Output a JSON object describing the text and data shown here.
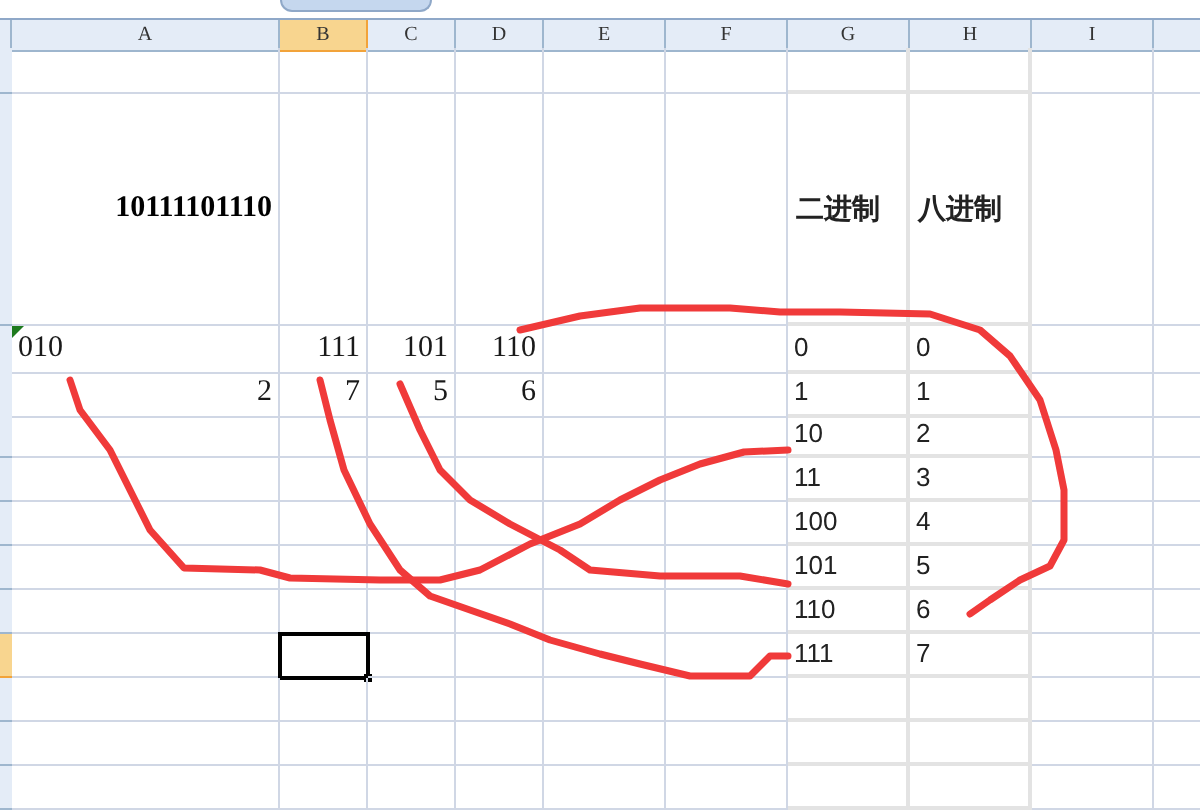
{
  "columns": [
    {
      "label": "A",
      "selected": false
    },
    {
      "label": "B",
      "selected": true
    },
    {
      "label": "C",
      "selected": false
    },
    {
      "label": "D",
      "selected": false
    },
    {
      "label": "E",
      "selected": false
    },
    {
      "label": "F",
      "selected": false
    },
    {
      "label": "G",
      "selected": false
    },
    {
      "label": "H",
      "selected": false
    },
    {
      "label": "I",
      "selected": false
    }
  ],
  "rows": [
    {
      "selected": false,
      "cells": [
        null,
        null,
        null,
        null,
        null,
        null,
        null,
        null,
        null
      ]
    },
    {
      "selected": false,
      "cells": [
        {
          "kind": "heading",
          "text": "10111101110"
        },
        null,
        null,
        null,
        null,
        null,
        {
          "kind": "table-heading",
          "text": "二进制"
        },
        {
          "kind": "table-heading",
          "text": "八进制"
        },
        null
      ]
    },
    {
      "selected": false,
      "cells": [
        {
          "kind": "text",
          "text": "010",
          "flagged": true
        },
        {
          "kind": "number",
          "text": "111"
        },
        {
          "kind": "number",
          "text": "101"
        },
        {
          "kind": "number",
          "text": "110"
        },
        null,
        null,
        {
          "kind": "table",
          "text": "0"
        },
        {
          "kind": "table",
          "text": "0"
        },
        null
      ]
    },
    {
      "selected": false,
      "cells": [
        {
          "kind": "number",
          "text": "2"
        },
        {
          "kind": "number",
          "text": "7"
        },
        {
          "kind": "number",
          "text": "5"
        },
        {
          "kind": "number",
          "text": "6"
        },
        null,
        null,
        {
          "kind": "table",
          "text": "1"
        },
        {
          "kind": "table",
          "text": "1"
        },
        null
      ]
    },
    {
      "selected": false,
      "cells": [
        null,
        null,
        null,
        null,
        null,
        null,
        {
          "kind": "table",
          "text": "10"
        },
        {
          "kind": "table",
          "text": "2"
        },
        null
      ]
    },
    {
      "selected": false,
      "cells": [
        null,
        null,
        null,
        null,
        null,
        null,
        {
          "kind": "table",
          "text": "11"
        },
        {
          "kind": "table",
          "text": "3"
        },
        null
      ]
    },
    {
      "selected": false,
      "cells": [
        null,
        null,
        null,
        null,
        null,
        null,
        {
          "kind": "table",
          "text": "100"
        },
        {
          "kind": "table",
          "text": "4"
        },
        null
      ]
    },
    {
      "selected": false,
      "cells": [
        null,
        null,
        null,
        null,
        null,
        null,
        {
          "kind": "table",
          "text": "101"
        },
        {
          "kind": "table",
          "text": "5"
        },
        null
      ]
    },
    {
      "selected": false,
      "cells": [
        null,
        null,
        null,
        null,
        null,
        null,
        {
          "kind": "table",
          "text": "110"
        },
        {
          "kind": "table",
          "text": "6"
        },
        null
      ]
    },
    {
      "selected": true,
      "cells": [
        null,
        null,
        null,
        null,
        null,
        null,
        {
          "kind": "table",
          "text": "111"
        },
        {
          "kind": "table",
          "text": "7"
        },
        null
      ]
    },
    {
      "selected": false,
      "cells": [
        null,
        null,
        null,
        null,
        null,
        null,
        null,
        null,
        null
      ]
    },
    {
      "selected": false,
      "cells": [
        null,
        null,
        null,
        null,
        null,
        null,
        null,
        null,
        null
      ]
    },
    {
      "selected": false,
      "cells": [
        null,
        null,
        null,
        null,
        null,
        null,
        null,
        null,
        null
      ]
    }
  ]
}
